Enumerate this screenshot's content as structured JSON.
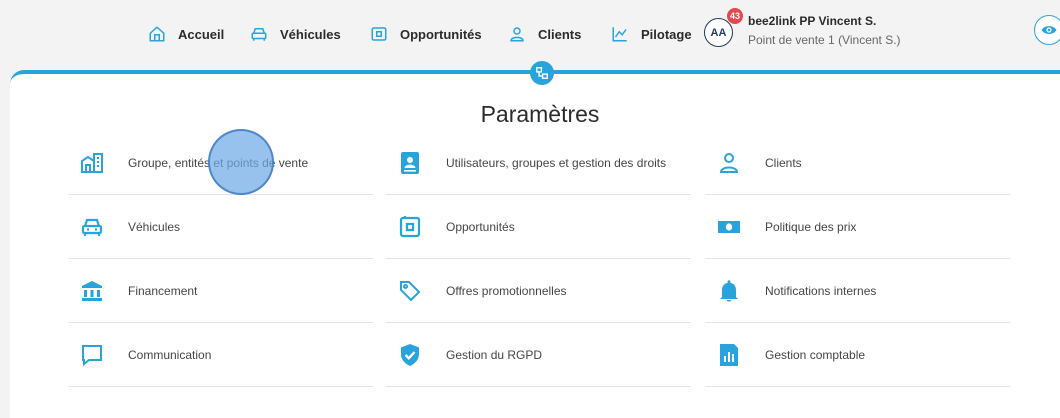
{
  "colors": {
    "accent": "#29a3dc",
    "badge": "#e5484d",
    "avatar_ring": "#1f3b59"
  },
  "nav": {
    "items": [
      {
        "label": "Accueil",
        "icon": "home-icon"
      },
      {
        "label": "Véhicules",
        "icon": "car-icon"
      },
      {
        "label": "Opportunités",
        "icon": "wallet-icon"
      },
      {
        "label": "Clients",
        "icon": "person-icon"
      },
      {
        "label": "Pilotage",
        "icon": "chart-line-icon"
      }
    ]
  },
  "user": {
    "initials": "AA",
    "notification_count": "43",
    "name": "bee2link PP Vincent S.",
    "store": "Point de vente 1 (Vincent S.)"
  },
  "page": {
    "title": "Paramètres"
  },
  "settings": {
    "col1": [
      {
        "label": "Groupe, entités et points de vente",
        "icon": "buildings-icon"
      },
      {
        "label": "Véhicules",
        "icon": "car-icon"
      },
      {
        "label": "Financement",
        "icon": "bank-icon"
      },
      {
        "label": "Communication",
        "icon": "chat-bubble-icon"
      }
    ],
    "col2": [
      {
        "label": "Utilisateurs, groupes et gestion des droits",
        "icon": "user-badge-icon"
      },
      {
        "label": "Opportunités",
        "icon": "wallet-icon"
      },
      {
        "label": "Offres promotionnelles",
        "icon": "tag-icon"
      },
      {
        "label": "Gestion du RGPD",
        "icon": "shield-check-icon"
      }
    ],
    "col3": [
      {
        "label": "Clients",
        "icon": "person-icon"
      },
      {
        "label": "Politique des prix",
        "icon": "banknote-icon"
      },
      {
        "label": "Notifications internes",
        "icon": "bell-icon"
      },
      {
        "label": "Gestion comptable",
        "icon": "report-icon"
      }
    ]
  }
}
